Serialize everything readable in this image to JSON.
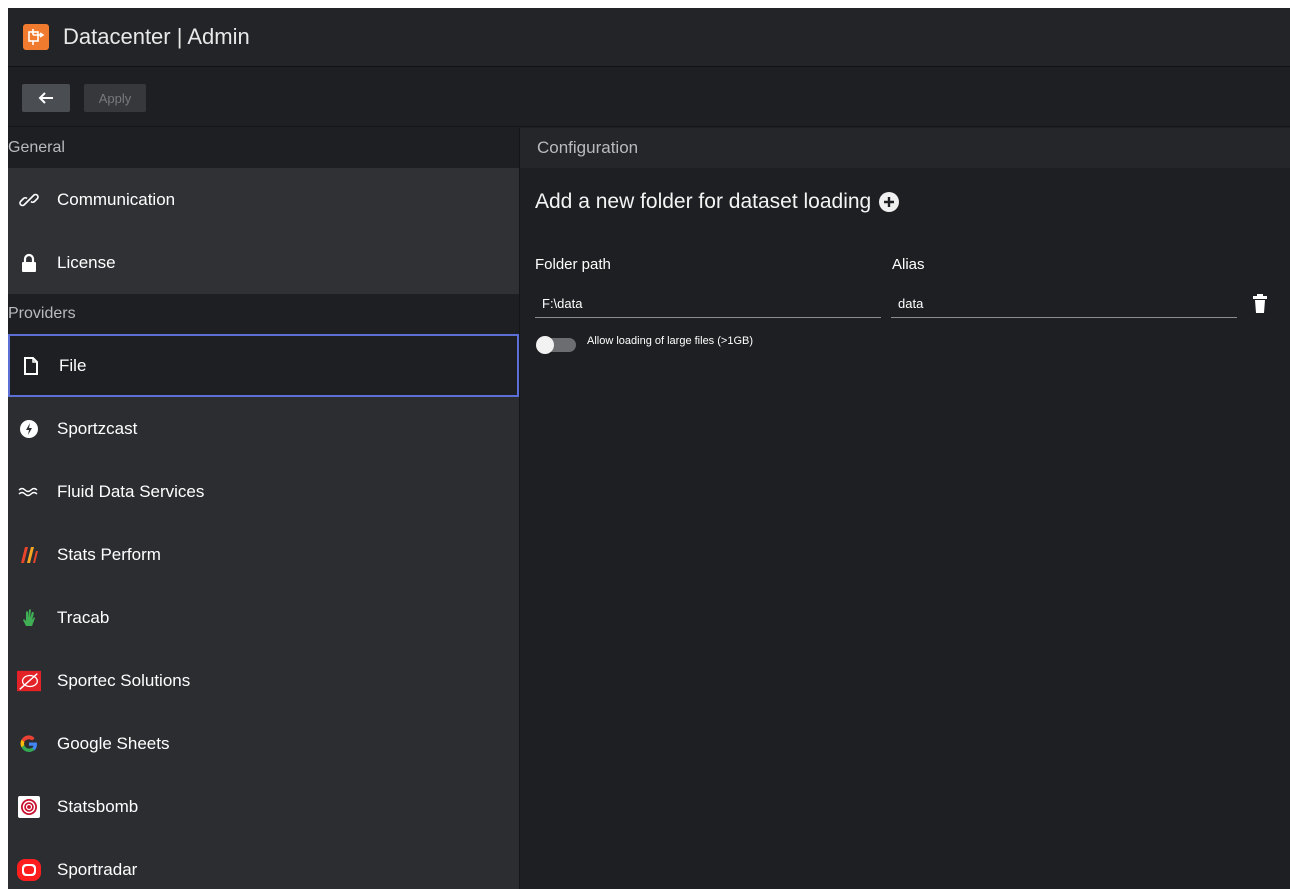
{
  "app": {
    "title": "Datacenter | Admin"
  },
  "toolbar": {
    "back_icon": "arrow-left-icon",
    "apply_label": "Apply"
  },
  "sidebar": {
    "general_header": "General",
    "general_items": [
      {
        "label": "Communication",
        "icon": "link-icon"
      },
      {
        "label": "License",
        "icon": "lock-icon"
      }
    ],
    "providers_header": "Providers",
    "provider_items": [
      {
        "label": "File",
        "icon": "file-icon",
        "selected": true
      },
      {
        "label": "Sportzcast",
        "icon": "sportzcast-icon"
      },
      {
        "label": "Fluid Data Services",
        "icon": "waves-icon"
      },
      {
        "label": "Stats Perform",
        "icon": "stats-perform-icon"
      },
      {
        "label": "Tracab",
        "icon": "tracab-icon"
      },
      {
        "label": "Sportec Solutions",
        "icon": "sportec-icon"
      },
      {
        "label": "Google Sheets",
        "icon": "google-icon"
      },
      {
        "label": "Statsbomb",
        "icon": "statsbomb-icon"
      },
      {
        "label": "Sportradar",
        "icon": "sportradar-icon"
      }
    ]
  },
  "main": {
    "header": "Configuration",
    "heading": "Add a new folder for dataset loading",
    "folder_path_label": "Folder path",
    "alias_label": "Alias",
    "folder_path_value": "F:\\data",
    "alias_value": "data",
    "toggle_label": "Allow loading of large files (>1GB)",
    "toggle_on": false
  },
  "colors": {
    "accent": "#5b6fd6",
    "logo": "#f07b2e"
  }
}
